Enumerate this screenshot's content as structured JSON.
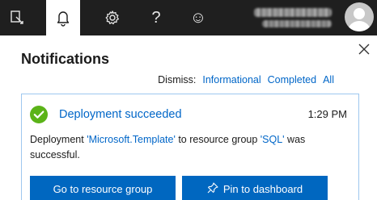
{
  "topbar": {
    "icons": [
      {
        "name": "feedback-icon"
      },
      {
        "name": "notifications-bell-icon",
        "active": true
      },
      {
        "name": "settings-gear-icon"
      },
      {
        "name": "help-icon",
        "glyph": "?"
      },
      {
        "name": "smiley-icon",
        "glyph": "☺"
      }
    ],
    "avatar": "user-avatar-icon"
  },
  "panel": {
    "title": "Notifications",
    "dismiss": {
      "label": "Dismiss:",
      "informational": "Informational",
      "completed": "Completed",
      "all": "All"
    }
  },
  "notification": {
    "title": "Deployment succeeded",
    "time": "1:29 PM",
    "body_prefix": "Deployment ",
    "template_name": "'Microsoft.Template'",
    "body_middle": " to resource group ",
    "group_name": "'SQL'",
    "body_suffix": " was successful.",
    "buttons": {
      "go": "Go to resource group",
      "pin": "Pin to dashboard"
    }
  },
  "colors": {
    "topbar_bg": "#1f1f1f",
    "link": "#0066c8",
    "button_bg": "#0067c0",
    "card_border": "#9ec7ef",
    "success": "#5bb318"
  }
}
